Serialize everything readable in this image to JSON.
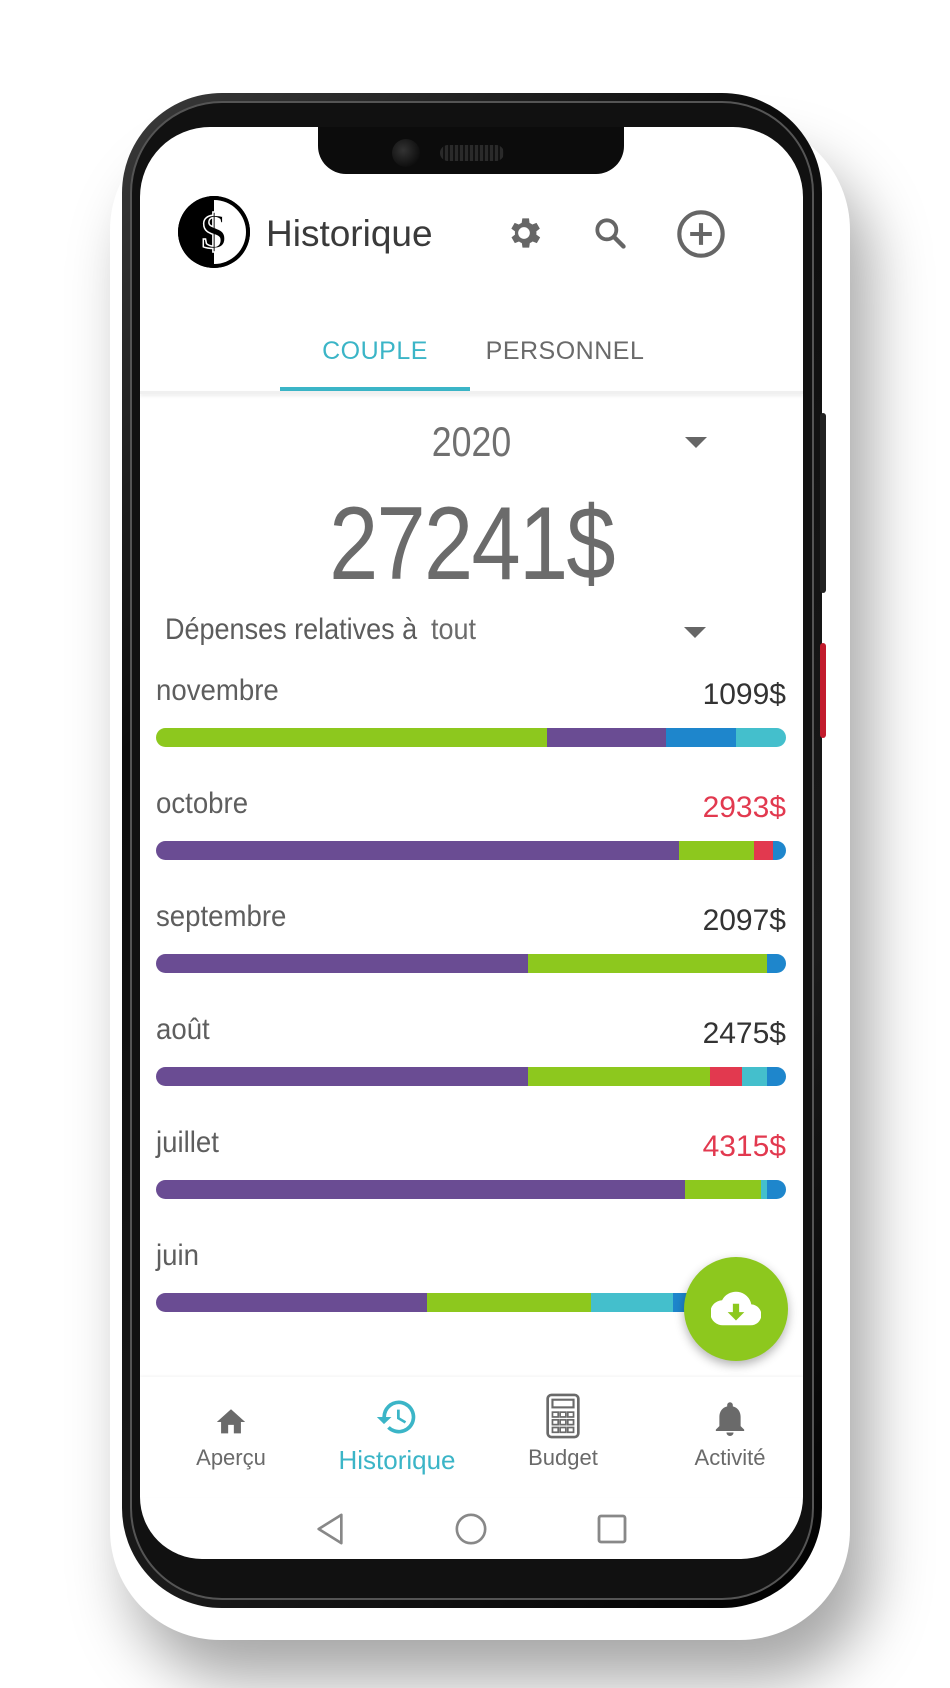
{
  "header": {
    "title": "Historique",
    "icons": [
      "app-logo-icon",
      "gear-icon",
      "search-icon",
      "add-circle-icon"
    ]
  },
  "tabs": [
    {
      "label": "COUPLE",
      "active": true
    },
    {
      "label": "PERSONNEL",
      "active": false
    }
  ],
  "colors": {
    "accent": "#3bb5c7",
    "over_budget": "#e2394f",
    "fab": "#8dc81e",
    "categories": {
      "green": "#8dc81e",
      "purple": "#6a4c93",
      "blue": "#1e86cc",
      "teal": "#44bfcc",
      "red": "#e2394f"
    }
  },
  "year": {
    "value": "2020"
  },
  "total": "27241$",
  "filter": {
    "label": "Dépenses relatives à",
    "value": "tout"
  },
  "months": [
    {
      "name": "novembre",
      "amount": "1099$",
      "over": false,
      "segments": [
        {
          "c": "green",
          "f": 0.62
        },
        {
          "c": "purple",
          "f": 0.19
        },
        {
          "c": "blue",
          "f": 0.11
        },
        {
          "c": "teal",
          "f": 0.08
        }
      ]
    },
    {
      "name": "octobre",
      "amount": "2933$",
      "over": true,
      "segments": [
        {
          "c": "purple",
          "f": 0.83
        },
        {
          "c": "green",
          "f": 0.12
        },
        {
          "c": "red",
          "f": 0.03
        },
        {
          "c": "blue",
          "f": 0.02
        }
      ]
    },
    {
      "name": "septembre",
      "amount": "2097$",
      "over": false,
      "segments": [
        {
          "c": "purple",
          "f": 0.59
        },
        {
          "c": "green",
          "f": 0.38
        },
        {
          "c": "blue",
          "f": 0.03
        }
      ]
    },
    {
      "name": "août",
      "amount": "2475$",
      "over": false,
      "segments": [
        {
          "c": "purple",
          "f": 0.59
        },
        {
          "c": "green",
          "f": 0.29
        },
        {
          "c": "red",
          "f": 0.05
        },
        {
          "c": "teal",
          "f": 0.04
        },
        {
          "c": "blue",
          "f": 0.03
        }
      ]
    },
    {
      "name": "juillet",
      "amount": "4315$",
      "over": true,
      "segments": [
        {
          "c": "purple",
          "f": 0.84
        },
        {
          "c": "green",
          "f": 0.12
        },
        {
          "c": "teal",
          "f": 0.01
        },
        {
          "c": "blue",
          "f": 0.03
        }
      ]
    },
    {
      "name": "juin",
      "amount": "",
      "over": false,
      "segments": [
        {
          "c": "purple",
          "f": 0.43
        },
        {
          "c": "green",
          "f": 0.26
        },
        {
          "c": "teal",
          "f": 0.13
        },
        {
          "c": "blue",
          "f": 0.11
        },
        {
          "c": "red",
          "f": 0.07
        }
      ]
    }
  ],
  "fab": {
    "icon": "cloud-download-icon"
  },
  "bottom_nav": [
    {
      "label": "Aperçu",
      "icon": "home-icon",
      "active": false
    },
    {
      "label": "Historique",
      "icon": "history-icon",
      "active": true
    },
    {
      "label": "Budget",
      "icon": "calculator-icon",
      "active": false
    },
    {
      "label": "Activité",
      "icon": "bell-icon",
      "active": false
    }
  ],
  "system_nav": [
    "back-icon",
    "home-circle-icon",
    "recents-icon"
  ]
}
